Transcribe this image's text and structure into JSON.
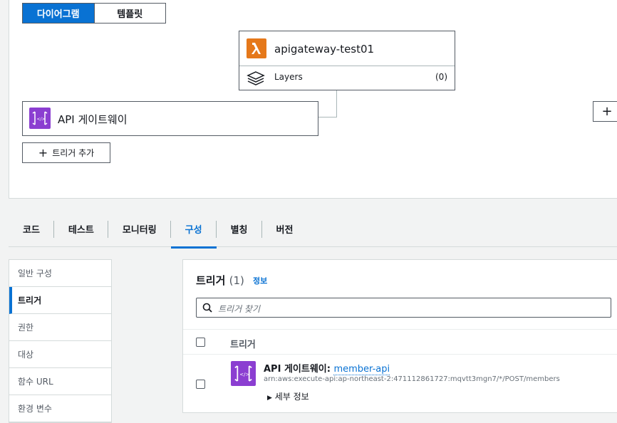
{
  "segmented": {
    "diagram_label": "다이어그램",
    "template_label": "템플릿"
  },
  "function_node": {
    "name": "apigateway-test01",
    "layers_label": "Layers",
    "layers_count": "(0)"
  },
  "api_node": {
    "label": "API 게이트웨이"
  },
  "add_trigger": {
    "label": "트리거 추가"
  },
  "add_destination": {
    "label": "+"
  },
  "tabs": [
    {
      "label": "코드"
    },
    {
      "label": "테스트"
    },
    {
      "label": "모니터링"
    },
    {
      "label": "구성"
    },
    {
      "label": "별칭"
    },
    {
      "label": "버전"
    }
  ],
  "sidenav": {
    "items": [
      {
        "label": "일반 구성"
      },
      {
        "label": "트리거"
      },
      {
        "label": "권한"
      },
      {
        "label": "대상"
      },
      {
        "label": "함수 URL"
      },
      {
        "label": "환경 변수"
      }
    ]
  },
  "triggers": {
    "title": "트리거",
    "count": "(1)",
    "info": "정보",
    "search_placeholder": "트리거 찾기",
    "column_header": "트리거",
    "row": {
      "prefix": "API 게이트웨이: ",
      "link": "member-api",
      "arn": "arn:aws:execute-api:ap-northeast-2:471112861727:mqvtt3mgn7/*/POST/members",
      "details": "세부 정보"
    }
  },
  "colors": {
    "accent": "#0972d3",
    "lambda": "#e5781a",
    "apigw": "#8b3ed1"
  }
}
